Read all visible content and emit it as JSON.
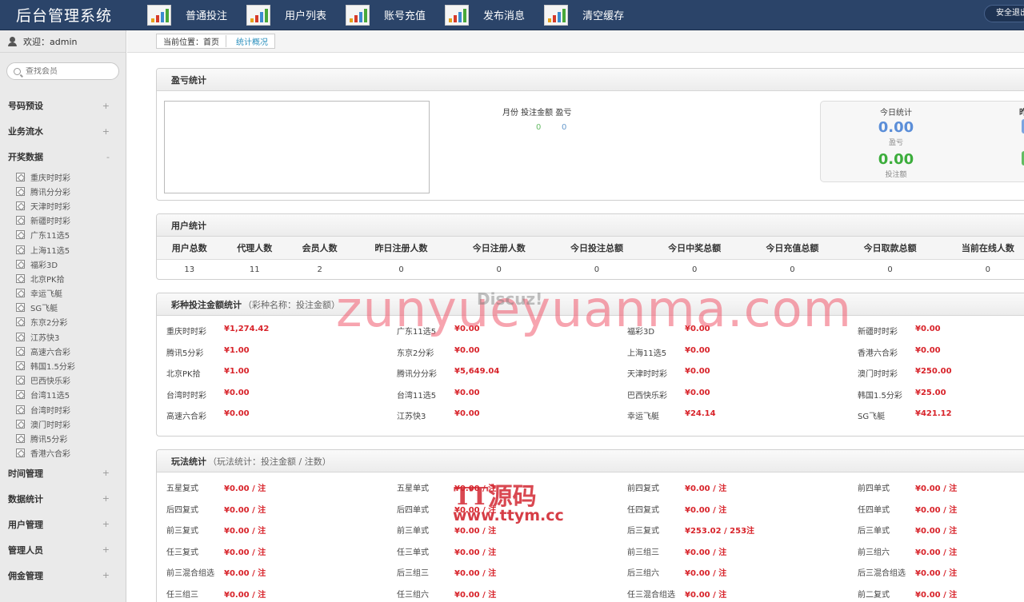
{
  "header": {
    "brand": "后台管理系统",
    "nav": [
      "普通投注",
      "用户列表",
      "账号充值",
      "发布消息",
      "清空缓存"
    ],
    "safe_exit": "安全退出"
  },
  "sidebar": {
    "welcome": "欢迎：admin",
    "search_placeholder": "查找会员",
    "groups_before": [
      {
        "label": "号码预设",
        "toggle": "+"
      },
      {
        "label": "业务流水",
        "toggle": "+"
      },
      {
        "label": "开奖数据",
        "toggle": "-"
      }
    ],
    "lottery_items": [
      "重庆时时彩",
      "腾讯分分彩",
      "天津时时彩",
      "新疆时时彩",
      "广东11选5",
      "上海11选5",
      "福彩3D",
      "北京PK拾",
      "幸运飞艇",
      "SG飞艇",
      "东京2分彩",
      "江苏快3",
      "高速六合彩",
      "韩国1.5分彩",
      "巴西快乐彩",
      "台湾11选5",
      "台湾时时彩",
      "澳门时时彩",
      "腾讯5分彩",
      "香港六合彩"
    ],
    "groups_after": [
      {
        "label": "时间管理",
        "toggle": "+"
      },
      {
        "label": "数据统计",
        "toggle": "+"
      },
      {
        "label": "用户管理",
        "toggle": "+"
      },
      {
        "label": "管理人员",
        "toggle": "+"
      },
      {
        "label": "佣金管理",
        "toggle": "+"
      }
    ]
  },
  "breadcrumb": {
    "home": "当前位置：首页",
    "current": "统计概况"
  },
  "profit_panel": {
    "title": "盈亏统计",
    "legend": "月份 投注金额 盈亏",
    "v1": "0",
    "v2": "0",
    "today_title": "今日统计",
    "next_title_partial": "昨",
    "profit_value": "0.00",
    "profit_label": "盈亏",
    "bet_value": "0.00",
    "bet_label": "投注额",
    "profit_color": "#5b8ed8",
    "bet_color": "#3cad3c"
  },
  "user_panel": {
    "title": "用户统计",
    "headers": [
      "用户总数",
      "代理人数",
      "会员人数",
      "昨日注册人数",
      "今日注册人数",
      "今日投注总额",
      "今日中奖总额",
      "今日充值总额",
      "今日取款总额",
      "当前在线人数"
    ],
    "values": [
      "13",
      "11",
      "2",
      "0",
      "0",
      "0",
      "0",
      "0",
      "0",
      "0"
    ]
  },
  "lottery_panel": {
    "title": "彩种投注金额统计",
    "note": "（彩种名称：投注金额）",
    "rows": [
      [
        [
          "重庆时时彩",
          "¥1,274.42"
        ],
        [
          "广东11选5",
          "¥0.00"
        ],
        [
          "福彩3D",
          "¥0.00"
        ],
        [
          "新疆时时彩",
          "¥0.00"
        ]
      ],
      [
        [
          "腾讯5分彩",
          "¥1.00"
        ],
        [
          "东京2分彩",
          "¥0.00"
        ],
        [
          "上海11选5",
          "¥0.00"
        ],
        [
          "香港六合彩",
          "¥0.00"
        ]
      ],
      [
        [
          "北京PK拾",
          "¥1.00"
        ],
        [
          "腾讯分分彩",
          "¥5,649.04"
        ],
        [
          "天津时时彩",
          "¥0.00"
        ],
        [
          "澳门时时彩",
          "¥250.00"
        ]
      ],
      [
        [
          "台湾时时彩",
          "¥0.00"
        ],
        [
          "台湾11选5",
          "¥0.00"
        ],
        [
          "巴西快乐彩",
          "¥0.00"
        ],
        [
          "韩国1.5分彩",
          "¥25.00"
        ]
      ],
      [
        [
          "高速六合彩",
          "¥0.00"
        ],
        [
          "江苏快3",
          "¥0.00"
        ],
        [
          "幸运飞艇",
          "¥24.14"
        ],
        [
          "SG飞艇",
          "¥421.12"
        ]
      ]
    ]
  },
  "play_panel": {
    "title": "玩法统计",
    "note": "（玩法统计：投注金额 / 注数）",
    "rows": [
      [
        [
          "五星复式",
          "¥0.00 / 注"
        ],
        [
          "五星单式",
          "¥0.00 / 注"
        ],
        [
          "前四复式",
          "¥0.00 / 注"
        ],
        [
          "前四单式",
          "¥0.00 / 注"
        ]
      ],
      [
        [
          "后四复式",
          "¥0.00 / 注"
        ],
        [
          "后四单式",
          "¥0.00 / 注"
        ],
        [
          "任四复式",
          "¥0.00 / 注"
        ],
        [
          "任四单式",
          "¥0.00 / 注"
        ]
      ],
      [
        [
          "前三复式",
          "¥0.00 / 注"
        ],
        [
          "前三单式",
          "¥0.00 / 注"
        ],
        [
          "后三复式",
          "¥253.02 / 253注"
        ],
        [
          "后三单式",
          "¥0.00 / 注"
        ]
      ],
      [
        [
          "任三复式",
          "¥0.00 / 注"
        ],
        [
          "任三单式",
          "¥0.00 / 注"
        ],
        [
          "前三组三",
          "¥0.00 / 注"
        ],
        [
          "前三组六",
          "¥0.00 / 注"
        ]
      ],
      [
        [
          "前三混合组选",
          "¥0.00 / 注"
        ],
        [
          "后三组三",
          "¥0.00 / 注"
        ],
        [
          "后三组六",
          "¥0.00 / 注"
        ],
        [
          "后三混合组选",
          "¥0.00 / 注"
        ]
      ],
      [
        [
          "任三组三",
          "¥0.00 / 注"
        ],
        [
          "任三组六",
          "¥0.00 / 注"
        ],
        [
          "任三混合组选",
          "¥0.00 / 注"
        ],
        [
          "前二复式",
          "¥0.00 / 注"
        ]
      ]
    ]
  },
  "watermarks": {
    "site": "zunyueyuanma.com",
    "discuz": "Discuz!",
    "brand_cn": "TT源码",
    "brand_url": "www.ttym.cc"
  }
}
